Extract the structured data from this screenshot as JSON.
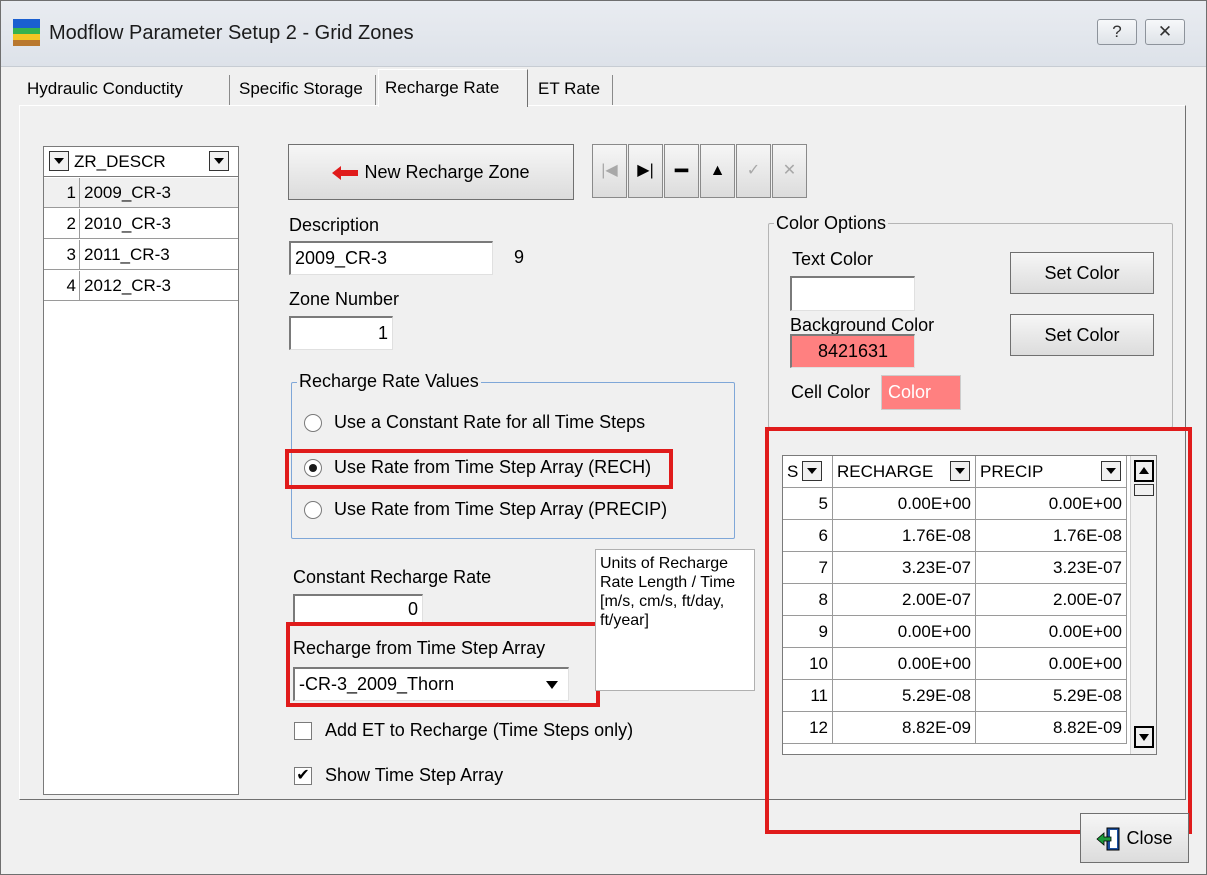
{
  "window": {
    "title": "Modflow Parameter Setup 2 - Grid Zones",
    "help_label": "?",
    "close_label": "✕"
  },
  "tabs": [
    {
      "label": "Hydraulic Conductity"
    },
    {
      "label": "Specific Storage"
    },
    {
      "label": "Recharge Rate"
    },
    {
      "label": "ET Rate"
    }
  ],
  "zone_list": {
    "header": "ZR_DESCR",
    "rows": [
      {
        "num": "1",
        "value": "2009_CR-3"
      },
      {
        "num": "2",
        "value": "2010_CR-3"
      },
      {
        "num": "3",
        "value": "2011_CR-3"
      },
      {
        "num": "4",
        "value": "2012_CR-3"
      }
    ]
  },
  "toolbar": {
    "new_zone_label": "New Recharge Zone"
  },
  "form": {
    "description_label": "Description",
    "description_value": "2009_CR-3",
    "description_count": "9",
    "zone_number_label": "Zone Number",
    "zone_number_value": "1",
    "recharge_group_title": "Recharge Rate Values",
    "radio_constant": "Use a Constant Rate for all Time Steps",
    "radio_rech": "Use Rate from Time Step Array (RECH)",
    "radio_precip": "Use Rate from Time Step Array (PRECIP)",
    "constant_rate_label": "Constant Recharge Rate",
    "constant_rate_value": "0",
    "array_label": "Recharge from Time Step Array",
    "array_value": "-CR-3_2009_Thorn",
    "units_text": "Units of Recharge Rate Length / Time [m/s, cm/s, ft/day, ft/year]",
    "add_et_label": "Add ET to Recharge (Time Steps only)",
    "add_et_checked": false,
    "show_array_label": "Show Time Step Array",
    "show_array_checked": true
  },
  "color_options": {
    "title": "Color Options",
    "text_color_label": "Text  Color",
    "text_color_value": "",
    "background_color_label": "Background  Color",
    "background_color_value": "8421631",
    "set_color_label_1": "Set Color",
    "set_color_label_2": "Set Color",
    "cell_color_label": "Cell Color",
    "cell_color_value": "Color",
    "swatch_color": "#ff8080"
  },
  "time_grid": {
    "col_s": "S",
    "col_recharge": "RECHARGE",
    "col_precip": "PRECIP",
    "rows": [
      {
        "s": "5",
        "recharge": "0.00E+00",
        "precip": "0.00E+00"
      },
      {
        "s": "6",
        "recharge": "1.76E-08",
        "precip": "1.76E-08"
      },
      {
        "s": "7",
        "recharge": "3.23E-07",
        "precip": "3.23E-07"
      },
      {
        "s": "8",
        "recharge": "2.00E-07",
        "precip": "2.00E-07"
      },
      {
        "s": "9",
        "recharge": "0.00E+00",
        "precip": "0.00E+00"
      },
      {
        "s": "10",
        "recharge": "0.00E+00",
        "precip": "0.00E+00"
      },
      {
        "s": "11",
        "recharge": "5.29E-08",
        "precip": "5.29E-08"
      },
      {
        "s": "12",
        "recharge": "8.82E-09",
        "precip": "8.82E-09"
      }
    ]
  },
  "footer": {
    "close_label": "Close"
  },
  "highlight_color": "#e01b1b"
}
